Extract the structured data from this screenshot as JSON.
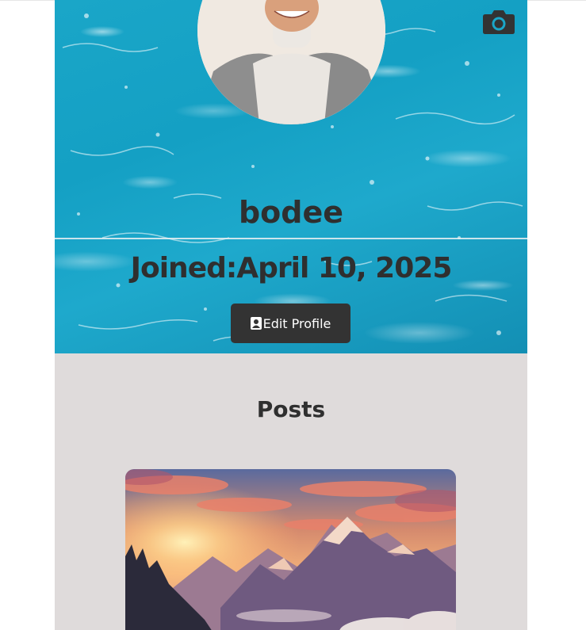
{
  "profile": {
    "username": "bodee",
    "joined_label": "Joined:",
    "joined_date": "April 10, 2025",
    "edit_button_label": "Edit Profile"
  },
  "icons": {
    "camera": "camera-icon",
    "edit": "contact-card-icon"
  },
  "posts": {
    "title": "Posts",
    "items": [
      {
        "image": "mountain-sunset"
      }
    ]
  },
  "colors": {
    "banner": "#1aa6c8",
    "text_dark": "#2f2f2f",
    "button_bg": "#333333",
    "posts_bg": "#dfdbdb"
  }
}
